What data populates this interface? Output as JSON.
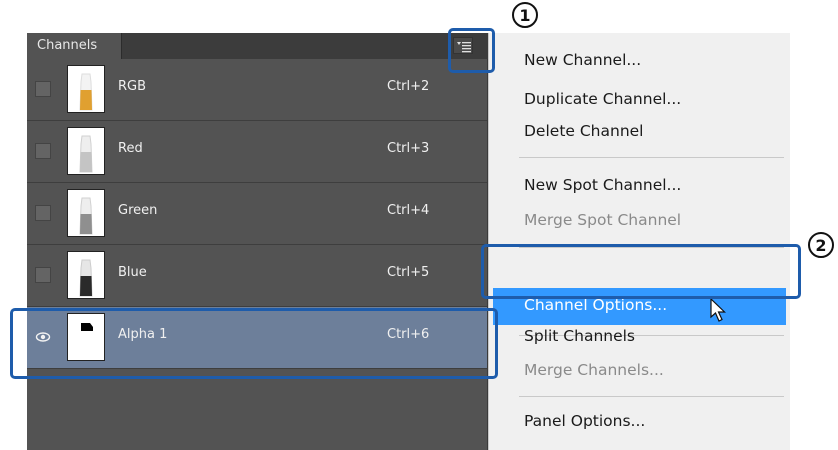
{
  "panel": {
    "tab_label": "Channels",
    "channels": [
      {
        "name": "RGB",
        "shortcut": "Ctrl+2",
        "thumb": "rgb"
      },
      {
        "name": "Red",
        "shortcut": "Ctrl+3",
        "thumb": "gray"
      },
      {
        "name": "Green",
        "shortcut": "Ctrl+4",
        "thumb": "gray"
      },
      {
        "name": "Blue",
        "shortcut": "Ctrl+5",
        "thumb": "dark"
      },
      {
        "name": "Alpha 1",
        "shortcut": "Ctrl+6",
        "thumb": "alpha",
        "selected": true,
        "visible": true
      }
    ]
  },
  "menu": {
    "items": [
      {
        "label": "New Channel..."
      },
      {
        "label": "Duplicate Channel..."
      },
      {
        "label": "Delete Channel"
      },
      {
        "label": "New Spot Channel..."
      },
      {
        "label": "Merge Spot Channel",
        "disabled": true
      },
      {
        "label": "Channel Options...",
        "highlighted": true
      },
      {
        "label": "Split Channels"
      },
      {
        "label": "Merge Channels...",
        "disabled": true
      },
      {
        "label": "Panel Options..."
      }
    ]
  },
  "callouts": {
    "one": "①",
    "two": "②"
  },
  "colors": {
    "highlight": "#3399ff",
    "callout": "#1e5cab",
    "selected_row": "#6d7f9a"
  }
}
